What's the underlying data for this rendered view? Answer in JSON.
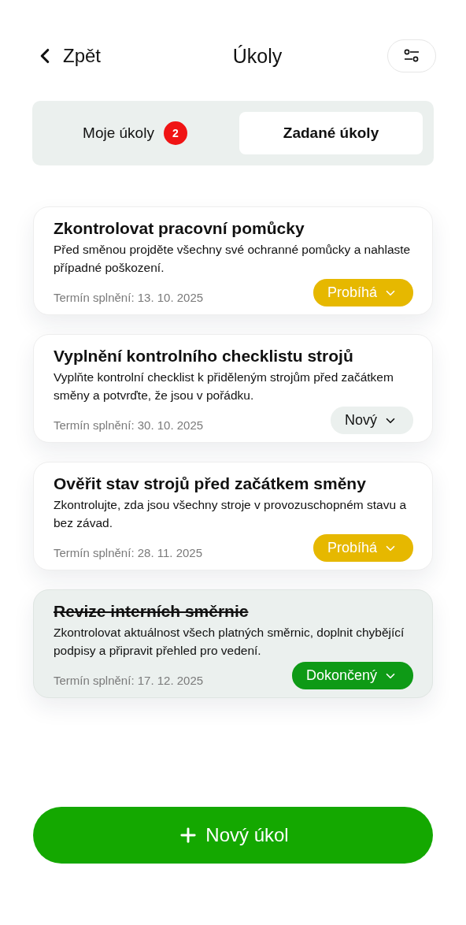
{
  "header": {
    "back": "Zpět",
    "title": "Úkoly"
  },
  "tabs": [
    {
      "label": "Moje úkoly",
      "badge": "2",
      "selected": false
    },
    {
      "label": "Zadané úkoly",
      "selected": true
    }
  ],
  "tasks": [
    {
      "title": "Zkontrolovat pracovní pomůcky",
      "description": "Před směnou projděte všechny své ochranné pomůcky a nahlaste případné poškození.",
      "due": "Termín splnění: 13. 10. 2025",
      "status": {
        "kind": "in_progress",
        "label": "Probíhá"
      },
      "completed": false
    },
    {
      "title": "Vyplnění kontrolního checklistu strojů",
      "description": "Vyplňte kontrolní checklist k přiděleným strojům před začátkem směny a potvrďte, že jsou v pořádku.",
      "due": "Termín splnění: 30. 10. 2025",
      "status": {
        "kind": "new",
        "label": "Nový"
      },
      "completed": false
    },
    {
      "title": "Ověřit stav strojů před začátkem směny",
      "description": "Zkontrolujte, zda jsou všechny stroje v provozuschopném stavu a bez závad.",
      "due": "Termín splnění: 28. 11. 2025",
      "status": {
        "kind": "in_progress",
        "label": "Probíhá"
      },
      "completed": false
    },
    {
      "title": "Revize interních směrnic",
      "description": "Zkontrolovat aktuálnost všech platných směrnic, doplnit chybějící podpisy a připravit přehled pro vedení.",
      "due": "Termín splnění: 17. 12. 2025",
      "status": {
        "kind": "done",
        "label": "Dokončený"
      },
      "completed": true
    }
  ],
  "new_task_button": "Nový úkol"
}
